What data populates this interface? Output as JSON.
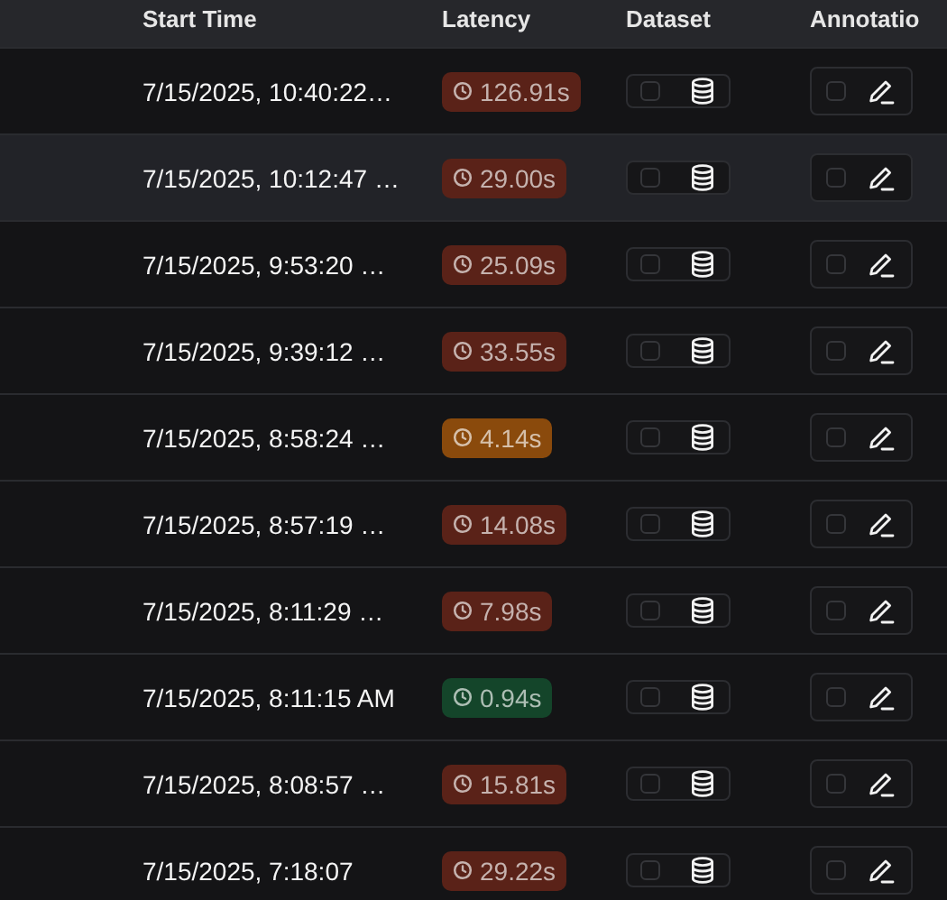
{
  "table": {
    "columns": [
      "Start Time",
      "Latency",
      "Dataset",
      "Annotatio"
    ],
    "rows": [
      {
        "start_time": "7/15/2025, 10:40:22…",
        "latency": {
          "text": "126.91s",
          "color": "#5a2218"
        },
        "selected": false,
        "dataset_checked": false,
        "annotation_checked": false
      },
      {
        "start_time": "7/15/2025, 10:12:47 …",
        "latency": {
          "text": "29.00s",
          "color": "#5a2218"
        },
        "selected": true,
        "dataset_checked": false,
        "annotation_checked": false
      },
      {
        "start_time": "7/15/2025, 9:53:20 …",
        "latency": {
          "text": "25.09s",
          "color": "#5a2218"
        },
        "selected": false,
        "dataset_checked": false,
        "annotation_checked": false
      },
      {
        "start_time": "7/15/2025, 9:39:12 …",
        "latency": {
          "text": "33.55s",
          "color": "#5a2218"
        },
        "selected": false,
        "dataset_checked": false,
        "annotation_checked": false
      },
      {
        "start_time": "7/15/2025, 8:58:24 …",
        "latency": {
          "text": "4.14s",
          "color": "#8a4a0c"
        },
        "selected": false,
        "dataset_checked": false,
        "annotation_checked": false
      },
      {
        "start_time": "7/15/2025, 8:57:19 …",
        "latency": {
          "text": "14.08s",
          "color": "#5a2218"
        },
        "selected": false,
        "dataset_checked": false,
        "annotation_checked": false
      },
      {
        "start_time": "7/15/2025, 8:11:29 …",
        "latency": {
          "text": "7.98s",
          "color": "#5a2218"
        },
        "selected": false,
        "dataset_checked": false,
        "annotation_checked": false
      },
      {
        "start_time": "7/15/2025, 8:11:15 AM",
        "latency": {
          "text": "0.94s",
          "color": "#14452a"
        },
        "selected": false,
        "dataset_checked": false,
        "annotation_checked": false
      },
      {
        "start_time": "7/15/2025, 8:08:57 …",
        "latency": {
          "text": "15.81s",
          "color": "#5a2218"
        },
        "selected": false,
        "dataset_checked": false,
        "annotation_checked": false
      },
      {
        "start_time": "7/15/2025, 7:18:07",
        "latency": {
          "text": "29.22s",
          "color": "#5a2218"
        },
        "selected": false,
        "dataset_checked": false,
        "annotation_checked": false
      }
    ]
  }
}
